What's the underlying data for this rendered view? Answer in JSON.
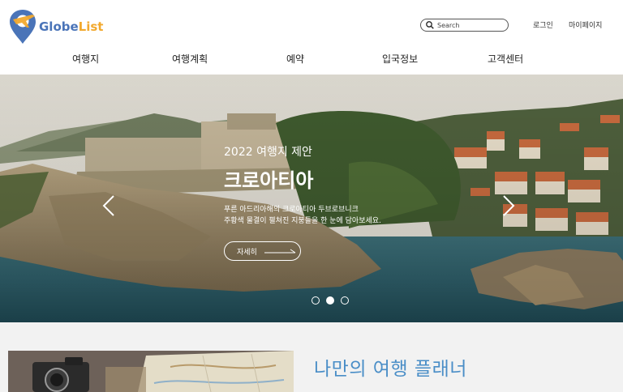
{
  "brand": {
    "name_part1": "Globe",
    "name_part2": "List",
    "colors": {
      "blue": "#4a74b8",
      "orange": "#f2a92e"
    }
  },
  "search": {
    "placeholder": "Search"
  },
  "util": {
    "login": "로그인",
    "mypage": "마이페이지"
  },
  "nav": [
    {
      "label": "여행지"
    },
    {
      "label": "여행계획"
    },
    {
      "label": "예약"
    },
    {
      "label": "입국정보"
    },
    {
      "label": "고객센터"
    }
  ],
  "hero": {
    "subtitle": "2022 여행지 제안",
    "title": "크로아티아",
    "desc_line1": "푸른 아드리아해의 크로아티아 두브로브니크",
    "desc_line2": "주황색 물결이 펼쳐진 지붕들을 한 눈에 담아보세요.",
    "button_label": "자세히",
    "slides": 3,
    "active_slide": 2
  },
  "planner": {
    "title": "나만의 여행 플래너"
  }
}
